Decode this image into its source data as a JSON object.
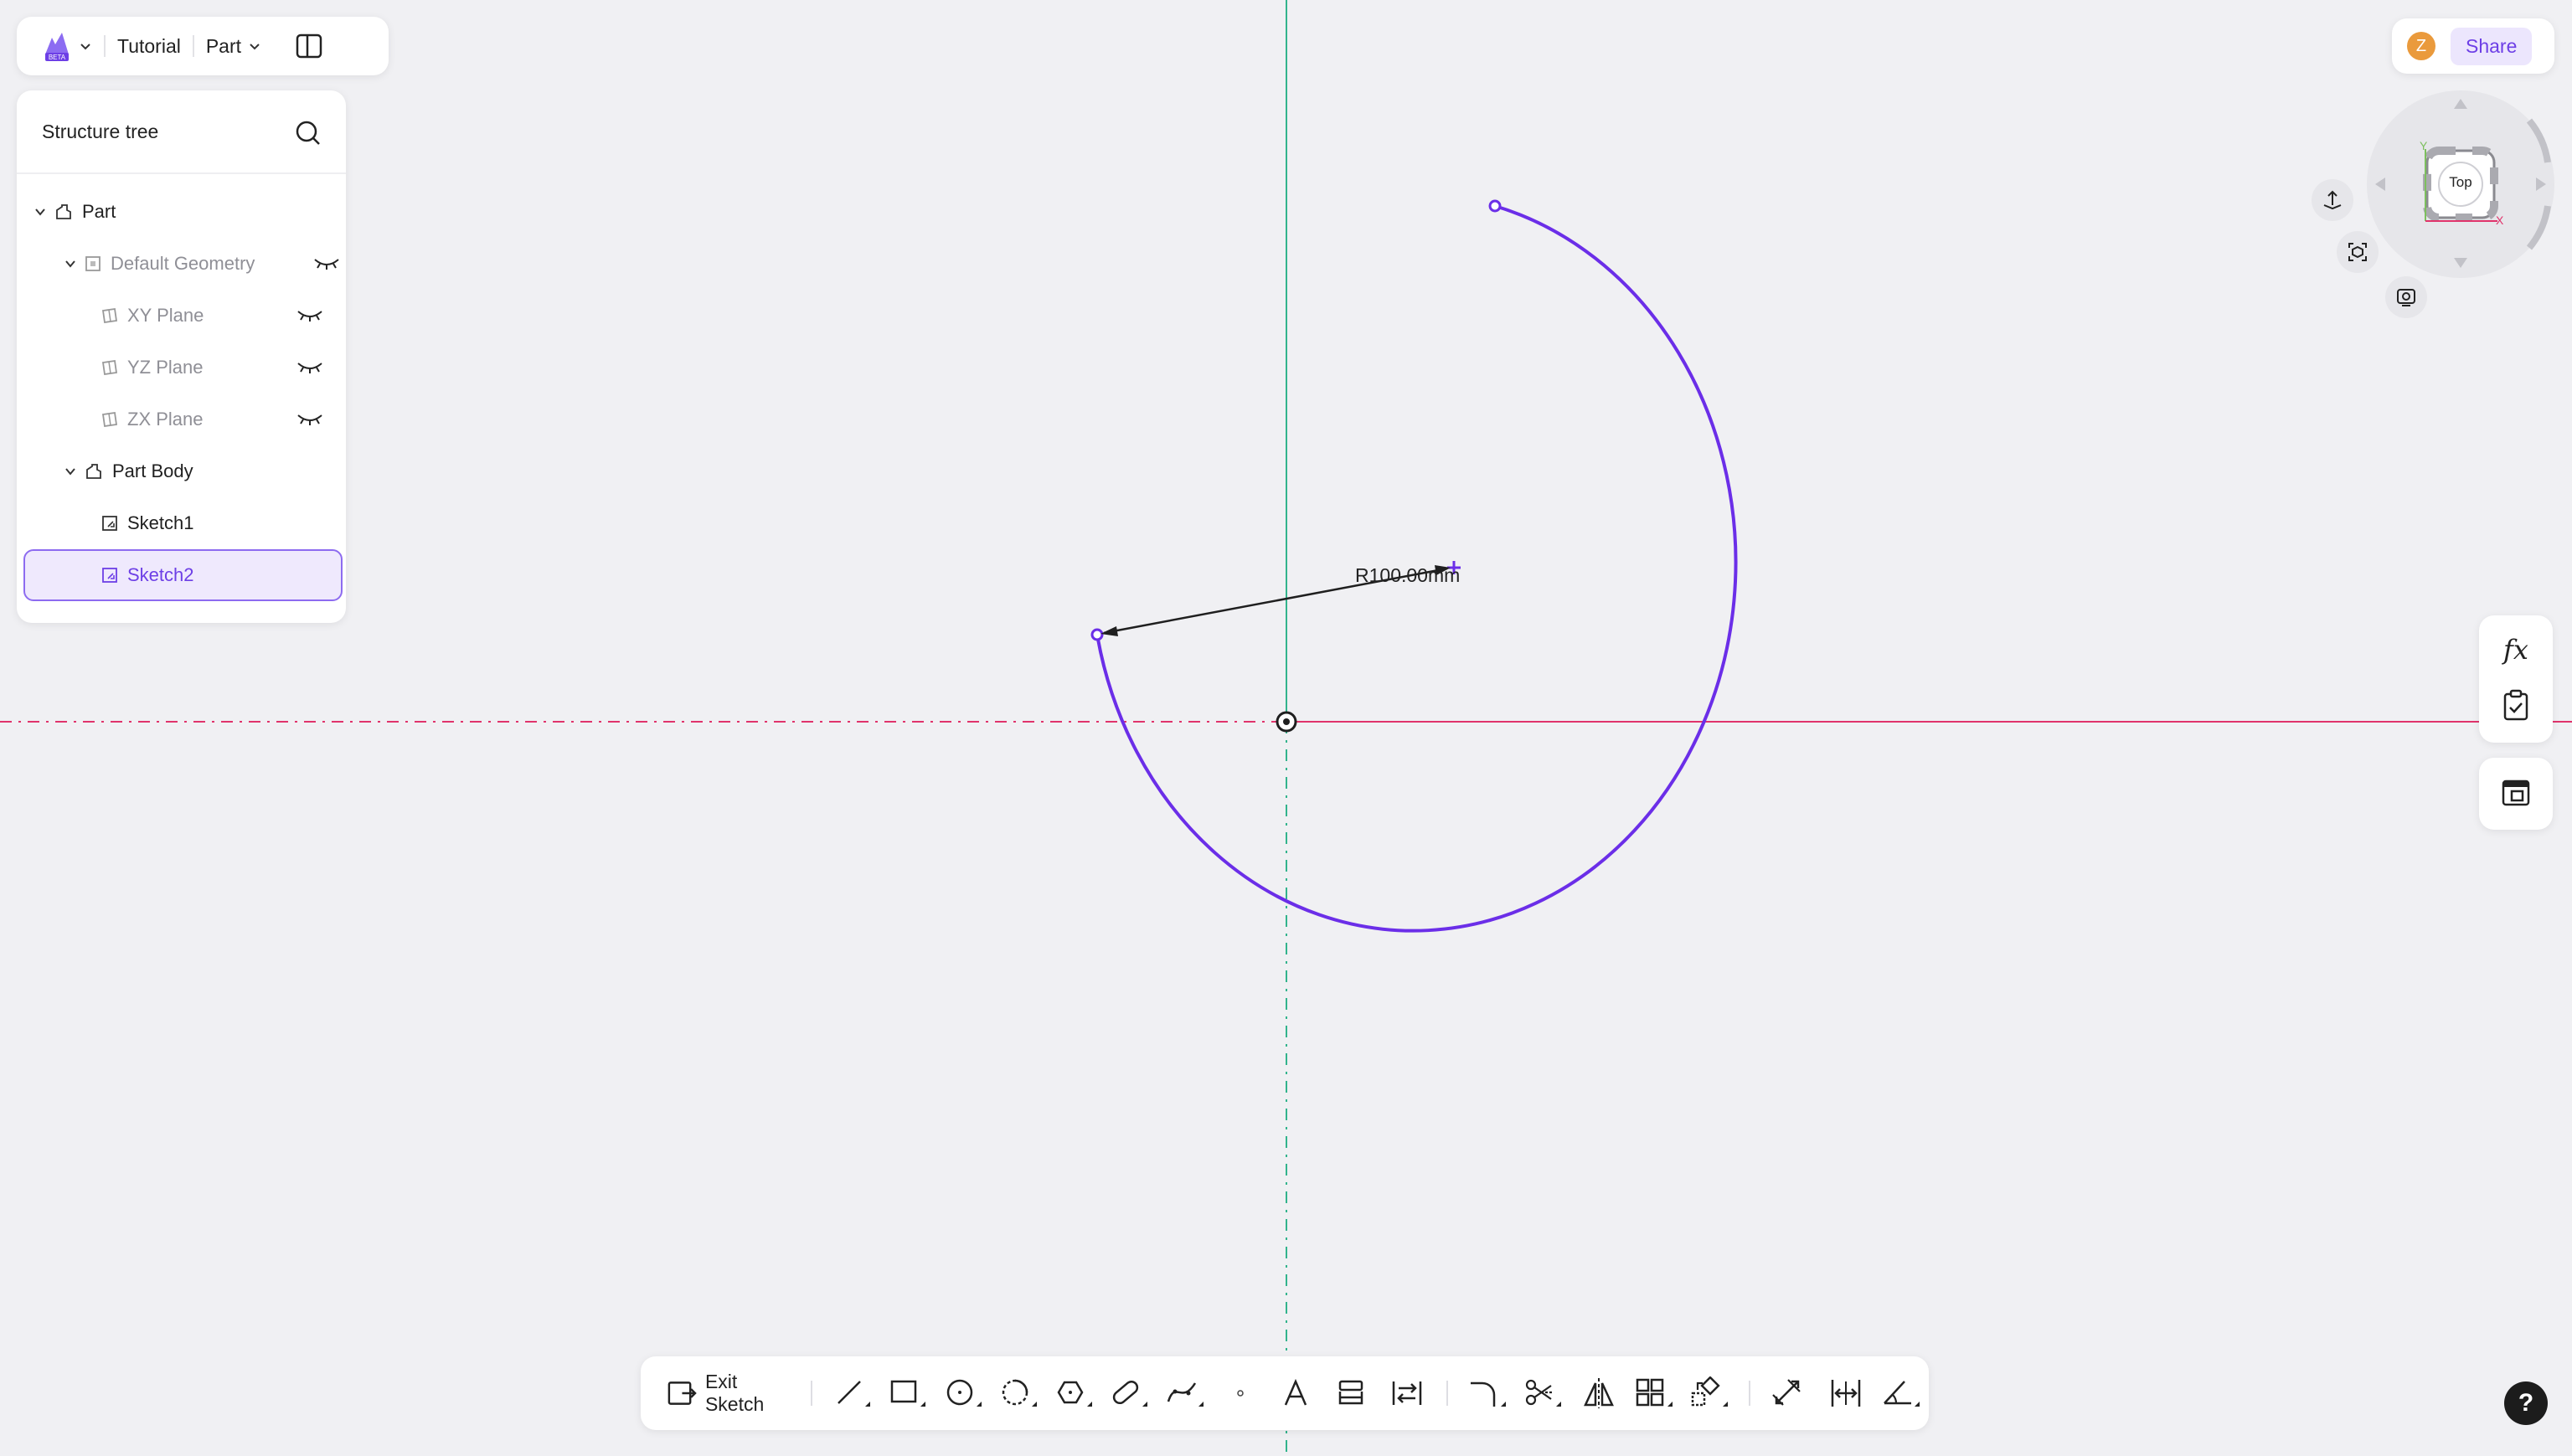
{
  "topbar": {
    "project_name": "Tutorial",
    "mode_label": "Part"
  },
  "structure_tree": {
    "title": "Structure tree",
    "items": [
      {
        "label": "Part"
      },
      {
        "label": "Default Geometry"
      },
      {
        "label": "XY Plane"
      },
      {
        "label": "YZ Plane"
      },
      {
        "label": "ZX Plane"
      },
      {
        "label": "Part Body"
      },
      {
        "label": "Sketch1"
      },
      {
        "label": "Sketch2"
      }
    ],
    "selected": "Sketch2"
  },
  "header_right": {
    "avatar_initial": "Z",
    "share_label": "Share"
  },
  "view_cube": {
    "face_label": "Top",
    "axis_labels": {
      "y": "Y",
      "x": "X"
    }
  },
  "sketch": {
    "dimension_label": "R100.00mm"
  },
  "toolbar": {
    "exit_label": "Exit Sketch",
    "tools": [
      "line-tool",
      "rectangle-tool",
      "circle-tool",
      "arc-tool",
      "polygon-tool",
      "slot-tool",
      "spline-tool",
      "point-tool",
      "text-tool",
      "project-tool",
      "convert-tool",
      "fillet-tool",
      "trim-tool",
      "mirror-tool",
      "pattern-tool",
      "transform-tool",
      "dimension-tool",
      "distance-tool",
      "angle-tool"
    ]
  },
  "right_panel": {
    "formula_label": "fx"
  },
  "colors": {
    "accent": "#6d3fe6",
    "sketch_curve": "#6b2ee8",
    "x_axis": "#e0336b",
    "y_axis": "#32b48c",
    "background": "#f0f0f3"
  }
}
